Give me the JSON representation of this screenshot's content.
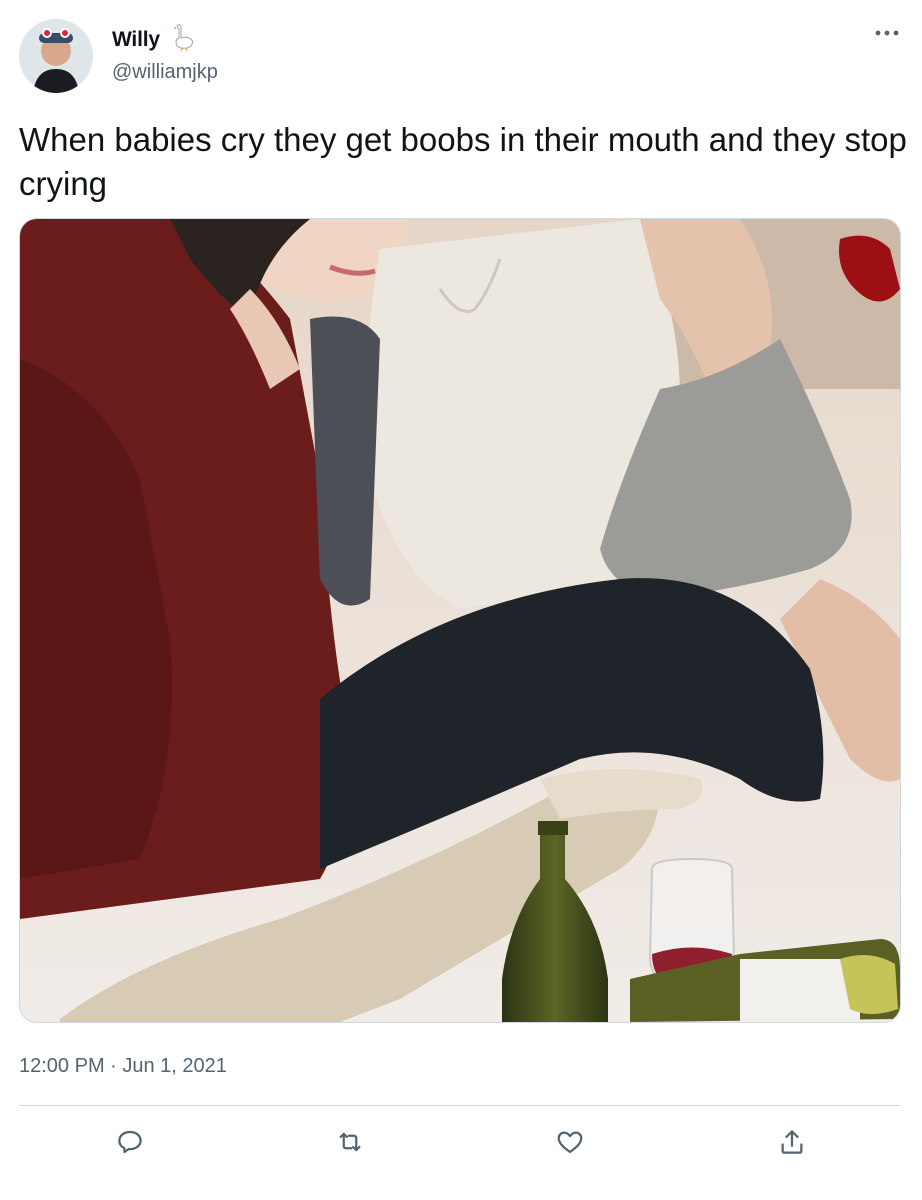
{
  "tweet": {
    "author": {
      "display_name": "Willy",
      "handle": "@williamjkp"
    },
    "text": "When babies cry they get boobs in their mouth and they stop crying",
    "timestamp": "12:00 PM · Jun 1, 2021"
  },
  "icons": {
    "verified_emoji": "goose-icon",
    "more": "more-icon",
    "reply": "reply-icon",
    "retweet": "retweet-icon",
    "like": "like-icon",
    "share": "share-icon"
  },
  "colors": {
    "text": "#0f1419",
    "secondary": "#536471",
    "divider": "#cfd9de"
  }
}
